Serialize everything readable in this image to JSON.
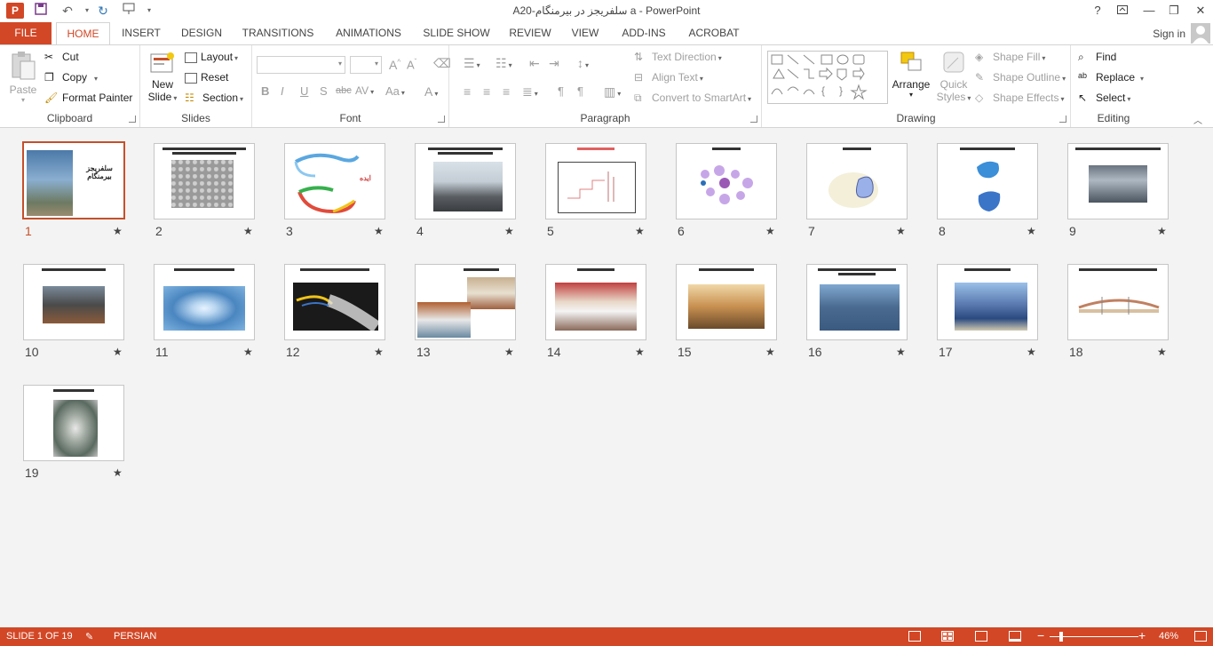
{
  "window": {
    "title": "A20-سلفریجز در بیرمنگام a - PowerPoint",
    "help": "?",
    "app_icon": "P"
  },
  "tabs": [
    "FILE",
    "HOME",
    "INSERT",
    "DESIGN",
    "TRANSITIONS",
    "ANIMATIONS",
    "SLIDE SHOW",
    "REVIEW",
    "VIEW",
    "ADD-INS",
    "ACROBAT"
  ],
  "active_tab": "HOME",
  "signin": "Sign in",
  "ribbon": {
    "clipboard": {
      "label": "Clipboard",
      "paste": "Paste",
      "cut": "Cut",
      "copy": "Copy",
      "format_painter": "Format Painter"
    },
    "slides": {
      "label": "Slides",
      "new_slide_1": "New",
      "new_slide_2": "Slide",
      "layout": "Layout",
      "reset": "Reset",
      "section": "Section"
    },
    "font": {
      "label": "Font",
      "bold": "B",
      "italic": "I",
      "underline": "U",
      "shadow": "S",
      "strike": "abc",
      "spacing": "AV",
      "case": "Aa",
      "color": "A"
    },
    "paragraph": {
      "label": "Paragraph",
      "text_direction": "Text Direction",
      "align_text": "Align Text",
      "convert_smartart": "Convert to SmartArt"
    },
    "drawing": {
      "label": "Drawing",
      "arrange": "Arrange",
      "quick_styles_1": "Quick",
      "quick_styles_2": "Styles",
      "shape_fill": "Shape Fill",
      "shape_outline": "Shape Outline",
      "shape_effects": "Shape Effects"
    },
    "editing": {
      "label": "Editing",
      "find": "Find",
      "replace": "Replace",
      "select": "Select"
    }
  },
  "slides": [
    {
      "n": "1",
      "selected": true
    },
    {
      "n": "2"
    },
    {
      "n": "3"
    },
    {
      "n": "4"
    },
    {
      "n": "5"
    },
    {
      "n": "6"
    },
    {
      "n": "7"
    },
    {
      "n": "8"
    },
    {
      "n": "9"
    },
    {
      "n": "10"
    },
    {
      "n": "11"
    },
    {
      "n": "12"
    },
    {
      "n": "13"
    },
    {
      "n": "14"
    },
    {
      "n": "15"
    },
    {
      "n": "16"
    },
    {
      "n": "17"
    },
    {
      "n": "18"
    },
    {
      "n": "19"
    }
  ],
  "slide_texts": {
    "s1": "سلفریجز بیرمنگام",
    "s3": "ایده"
  },
  "star": "★",
  "status": {
    "slide_info": "SLIDE 1 OF 19",
    "language": "PERSIAN",
    "zoom": "46%",
    "zoom_minus": "−",
    "zoom_plus": "+"
  },
  "colors": {
    "accent": "#d24726",
    "selected": "#c5502a"
  }
}
